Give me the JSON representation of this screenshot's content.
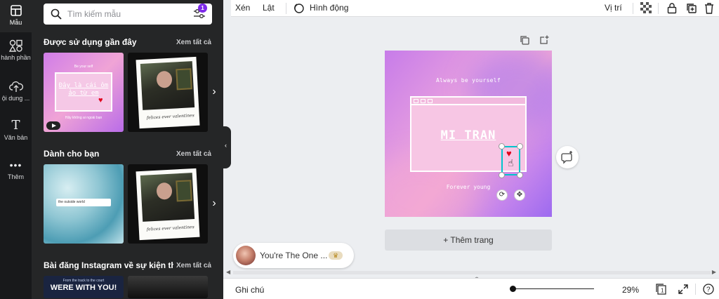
{
  "rail": {
    "items": [
      {
        "label": "Mẫu",
        "icon": "template-icon"
      },
      {
        "label": "hành phần",
        "icon": "elements-icon"
      },
      {
        "label": "ội dung ...",
        "icon": "upload-icon"
      },
      {
        "label": "Văn bản",
        "icon": "text-icon"
      },
      {
        "label": "Thêm",
        "icon": "more-icon"
      }
    ]
  },
  "panel": {
    "search_placeholder": "Tìm kiếm mẫu",
    "filter_badge": "1",
    "sections": [
      {
        "title": "Được sử dụng gần đây",
        "see_all": "Xem tất cả"
      },
      {
        "title": "Dành cho bạn",
        "see_all": "Xem tất cả"
      },
      {
        "title": "Bài đăng Instagram về sự kiện th...",
        "see_all": "Xem tất cả"
      }
    ],
    "thumb1": {
      "top": "Be your self",
      "window": "Đây là cái ôm ảo từ em",
      "bottom": "Hãy không ai ngoài bạn"
    },
    "polaroid_caption": "felices ever valentines",
    "waves_search": "the outside world",
    "banner": {
      "small": "From the track to the court",
      "big": "WERE WITH YOU!"
    }
  },
  "toolbar": {
    "crop": "Xén",
    "flip": "Lật",
    "animate": "Hình động",
    "position": "Vị trí"
  },
  "design": {
    "top_text": "Always be yourself",
    "name": "MI TRAN",
    "bottom_text": "Forever young"
  },
  "add_page": "+ Thêm trang",
  "music": {
    "title": "You're The One ..."
  },
  "bottombar": {
    "notes": "Ghi chú",
    "zoom": "29%",
    "page_count": "1"
  },
  "colors": {
    "accent": "#7d2ae8",
    "selection": "#00c4cc",
    "sidebar": "#18191b",
    "panel": "#252627"
  }
}
